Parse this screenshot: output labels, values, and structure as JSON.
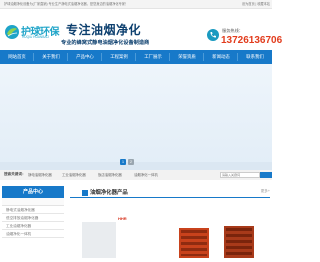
{
  "topbar": {
    "notice": "护球油烟净化设备为(厂家直销) 专业生产静电式油烟净化器，是您身边的油烟净化专家！",
    "links": "设为首页 | 收藏本站"
  },
  "header": {
    "logo_cn": "护球环保",
    "logo_en": "HUQIU HUANBAO",
    "slogan_main": "专注油烟净化",
    "slogan_sub": "专业的蜂窝式静电油烟净化设备制造商",
    "hotline_label": "服务热线：",
    "hotline_number": "13726136706"
  },
  "nav": {
    "items": [
      {
        "label": "网站首页"
      },
      {
        "label": "关于我们"
      },
      {
        "label": "产品中心"
      },
      {
        "label": "工程案例"
      },
      {
        "label": "工厂展示"
      },
      {
        "label": "荣誉资质"
      },
      {
        "label": "新闻动态"
      },
      {
        "label": "联系我们"
      }
    ]
  },
  "banner": {
    "slides": [
      {
        "label": "1"
      },
      {
        "label": "2"
      }
    ],
    "active_index": 0
  },
  "search": {
    "hot_label": "搜索关键词：",
    "keywords": [
      "静电油烟净化器",
      "工业油烟净化器",
      "饭店油烟净化器",
      "油烟净化一体机"
    ],
    "placeholder": "请输入关键词"
  },
  "sidebar": {
    "title": "产品中心",
    "subtitle": "PRODUCT CENTER",
    "items": [
      {
        "label": "静电式油烟净化器"
      },
      {
        "label": "低空排放油烟净化器"
      },
      {
        "label": "工业油烟净化器"
      },
      {
        "label": "油烟净化一体机"
      }
    ]
  },
  "main": {
    "section_title": "油烟净化器产品",
    "more": "更多+",
    "product_tag": "HHR"
  },
  "colors": {
    "brand_blue": "#1779c9",
    "logo_cyan": "#1ea4c8",
    "hotline_red": "#e23c1d",
    "slogan_navy": "#0c3f6e",
    "dot_active": "#1779c9",
    "dot_inactive": "#9aa6b0"
  },
  "icons": {
    "logo": "leaf-globe-icon",
    "hotline": "phone-icon",
    "search": "search-icon"
  }
}
